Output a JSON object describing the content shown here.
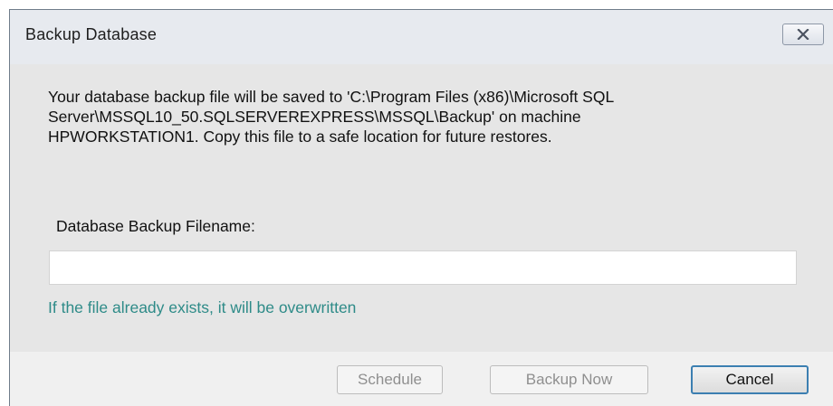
{
  "window": {
    "title": "Backup Database",
    "close_icon": "close-x-icon"
  },
  "message": {
    "line1": "Your database backup file will be saved to 'C:\\Program Files (x86)\\Microsoft SQL",
    "line2": "Server\\MSSQL10_50.SQLSERVEREXPRESS\\MSSQL\\Backup' on machine",
    "line3": "HPWORKSTATION1. Copy this file to a safe location for future restores."
  },
  "filename": {
    "label": "Database Backup Filename:",
    "value": "",
    "hint": "If the file already exists, it will be overwritten"
  },
  "buttons": {
    "schedule": "Schedule",
    "backup_now": "Backup Now",
    "cancel": "Cancel"
  },
  "colors": {
    "hint_text": "#2e8b88",
    "focus_border": "#3c7fb1"
  }
}
